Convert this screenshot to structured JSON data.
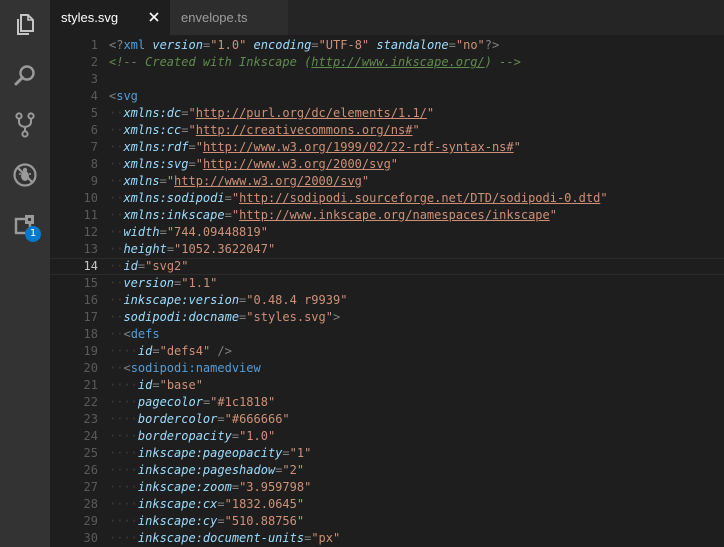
{
  "activity_bar": {
    "items": [
      {
        "name": "explorer-icon"
      },
      {
        "name": "search-icon"
      },
      {
        "name": "source-control-icon"
      },
      {
        "name": "debug-icon"
      },
      {
        "name": "extensions-icon"
      }
    ],
    "badge": "1"
  },
  "tabs": [
    {
      "label": "styles.svg",
      "active": true
    },
    {
      "label": "envelope.ts",
      "active": false
    }
  ],
  "editor": {
    "current_line": 14,
    "lines": [
      {
        "n": "1",
        "indent": 0,
        "tokens": [
          [
            "punc",
            "<?"
          ],
          [
            "tag",
            "xml"
          ],
          [
            "txt",
            " "
          ],
          [
            "attr",
            "version"
          ],
          [
            "punc",
            "="
          ],
          [
            "str",
            "\"1.0\""
          ],
          [
            "txt",
            " "
          ],
          [
            "attr",
            "encoding"
          ],
          [
            "punc",
            "="
          ],
          [
            "str",
            "\"UTF-8\""
          ],
          [
            "txt",
            " "
          ],
          [
            "attr",
            "standalone"
          ],
          [
            "punc",
            "="
          ],
          [
            "str",
            "\"no\""
          ],
          [
            "punc",
            "?>"
          ]
        ]
      },
      {
        "n": "2",
        "indent": 0,
        "tokens": [
          [
            "com",
            "<!-- Created with Inkscape ("
          ],
          [
            "comurl",
            "http://www.inkscape.org/"
          ],
          [
            "com",
            ") -->"
          ]
        ]
      },
      {
        "n": "3",
        "indent": 0,
        "tokens": []
      },
      {
        "n": "4",
        "indent": 0,
        "tokens": [
          [
            "punc",
            "<"
          ],
          [
            "tag",
            "svg"
          ]
        ]
      },
      {
        "n": "5",
        "indent": 1,
        "tokens": [
          [
            "attr",
            "xmlns:dc"
          ],
          [
            "punc",
            "="
          ],
          [
            "str",
            "\""
          ],
          [
            "url",
            "http://purl.org/dc/elements/1.1/"
          ],
          [
            "str",
            "\""
          ]
        ]
      },
      {
        "n": "6",
        "indent": 1,
        "tokens": [
          [
            "attr",
            "xmlns:cc"
          ],
          [
            "punc",
            "="
          ],
          [
            "str",
            "\""
          ],
          [
            "url",
            "http://creativecommons.org/ns#"
          ],
          [
            "str",
            "\""
          ]
        ]
      },
      {
        "n": "7",
        "indent": 1,
        "tokens": [
          [
            "attr",
            "xmlns:rdf"
          ],
          [
            "punc",
            "="
          ],
          [
            "str",
            "\""
          ],
          [
            "url",
            "http://www.w3.org/1999/02/22-rdf-syntax-ns#"
          ],
          [
            "str",
            "\""
          ]
        ]
      },
      {
        "n": "8",
        "indent": 1,
        "tokens": [
          [
            "attr",
            "xmlns:svg"
          ],
          [
            "punc",
            "="
          ],
          [
            "str",
            "\""
          ],
          [
            "url",
            "http://www.w3.org/2000/svg"
          ],
          [
            "str",
            "\""
          ]
        ]
      },
      {
        "n": "9",
        "indent": 1,
        "tokens": [
          [
            "attr",
            "xmlns"
          ],
          [
            "punc",
            "="
          ],
          [
            "str",
            "\""
          ],
          [
            "url",
            "http://www.w3.org/2000/svg"
          ],
          [
            "str",
            "\""
          ]
        ]
      },
      {
        "n": "10",
        "indent": 1,
        "tokens": [
          [
            "attr",
            "xmlns:sodipodi"
          ],
          [
            "punc",
            "="
          ],
          [
            "str",
            "\""
          ],
          [
            "url",
            "http://sodipodi.sourceforge.net/DTD/sodipodi-0.dtd"
          ],
          [
            "str",
            "\""
          ]
        ]
      },
      {
        "n": "11",
        "indent": 1,
        "tokens": [
          [
            "attr",
            "xmlns:inkscape"
          ],
          [
            "punc",
            "="
          ],
          [
            "str",
            "\""
          ],
          [
            "url",
            "http://www.inkscape.org/namespaces/inkscape"
          ],
          [
            "str",
            "\""
          ]
        ]
      },
      {
        "n": "12",
        "indent": 1,
        "tokens": [
          [
            "attr",
            "width"
          ],
          [
            "punc",
            "="
          ],
          [
            "str",
            "\"744.09448819\""
          ]
        ]
      },
      {
        "n": "13",
        "indent": 1,
        "tokens": [
          [
            "attr",
            "height"
          ],
          [
            "punc",
            "="
          ],
          [
            "str",
            "\"1052.3622047\""
          ]
        ]
      },
      {
        "n": "14",
        "indent": 1,
        "tokens": [
          [
            "attr",
            "id"
          ],
          [
            "punc",
            "="
          ],
          [
            "str",
            "\"svg2\""
          ]
        ]
      },
      {
        "n": "15",
        "indent": 1,
        "tokens": [
          [
            "attr",
            "version"
          ],
          [
            "punc",
            "="
          ],
          [
            "str",
            "\"1.1\""
          ]
        ]
      },
      {
        "n": "16",
        "indent": 1,
        "tokens": [
          [
            "attr",
            "inkscape:version"
          ],
          [
            "punc",
            "="
          ],
          [
            "str",
            "\"0.48.4 r9939\""
          ]
        ]
      },
      {
        "n": "17",
        "indent": 1,
        "tokens": [
          [
            "attr",
            "sodipodi:docname"
          ],
          [
            "punc",
            "="
          ],
          [
            "str",
            "\"styles.svg\""
          ],
          [
            "punc",
            ">"
          ]
        ]
      },
      {
        "n": "18",
        "indent": 1,
        "tokens": [
          [
            "punc",
            "<"
          ],
          [
            "tag",
            "defs"
          ]
        ]
      },
      {
        "n": "19",
        "indent": 2,
        "tokens": [
          [
            "attr",
            "id"
          ],
          [
            "punc",
            "="
          ],
          [
            "str",
            "\"defs4\""
          ],
          [
            "txt",
            " "
          ],
          [
            "punc",
            "/>"
          ]
        ]
      },
      {
        "n": "20",
        "indent": 1,
        "tokens": [
          [
            "punc",
            "<"
          ],
          [
            "tag",
            "sodipodi:namedview"
          ]
        ]
      },
      {
        "n": "21",
        "indent": 2,
        "tokens": [
          [
            "attr",
            "id"
          ],
          [
            "punc",
            "="
          ],
          [
            "str",
            "\"base\""
          ]
        ]
      },
      {
        "n": "22",
        "indent": 2,
        "tokens": [
          [
            "attr",
            "pagecolor"
          ],
          [
            "punc",
            "="
          ],
          [
            "str",
            "\"#1c1818\""
          ]
        ]
      },
      {
        "n": "23",
        "indent": 2,
        "tokens": [
          [
            "attr",
            "bordercolor"
          ],
          [
            "punc",
            "="
          ],
          [
            "str",
            "\"#666666\""
          ]
        ]
      },
      {
        "n": "24",
        "indent": 2,
        "tokens": [
          [
            "attr",
            "borderopacity"
          ],
          [
            "punc",
            "="
          ],
          [
            "str",
            "\"1.0\""
          ]
        ]
      },
      {
        "n": "25",
        "indent": 2,
        "tokens": [
          [
            "attr",
            "inkscape:pageopacity"
          ],
          [
            "punc",
            "="
          ],
          [
            "str",
            "\"1\""
          ]
        ]
      },
      {
        "n": "26",
        "indent": 2,
        "tokens": [
          [
            "attr",
            "inkscape:pageshadow"
          ],
          [
            "punc",
            "="
          ],
          [
            "str",
            "\"2\""
          ]
        ]
      },
      {
        "n": "27",
        "indent": 2,
        "tokens": [
          [
            "attr",
            "inkscape:zoom"
          ],
          [
            "punc",
            "="
          ],
          [
            "str",
            "\"3.959798\""
          ]
        ]
      },
      {
        "n": "28",
        "indent": 2,
        "tokens": [
          [
            "attr",
            "inkscape:cx"
          ],
          [
            "punc",
            "="
          ],
          [
            "str",
            "\"1832.0645\""
          ]
        ]
      },
      {
        "n": "29",
        "indent": 2,
        "tokens": [
          [
            "attr",
            "inkscape:cy"
          ],
          [
            "punc",
            "="
          ],
          [
            "str",
            "\"510.88756\""
          ]
        ]
      },
      {
        "n": "30",
        "indent": 2,
        "tokens": [
          [
            "attr",
            "inkscape:document-units"
          ],
          [
            "punc",
            "="
          ],
          [
            "str",
            "\"px\""
          ]
        ]
      }
    ]
  },
  "colors": {
    "activity_bar": "#333333",
    "editor_bg": "#1e1e1e",
    "tab_bar": "#252526",
    "badge": "#007acc",
    "attribute": "#9cdcfe",
    "string": "#ce9178",
    "tag": "#569cd6",
    "comment": "#608b4e"
  }
}
